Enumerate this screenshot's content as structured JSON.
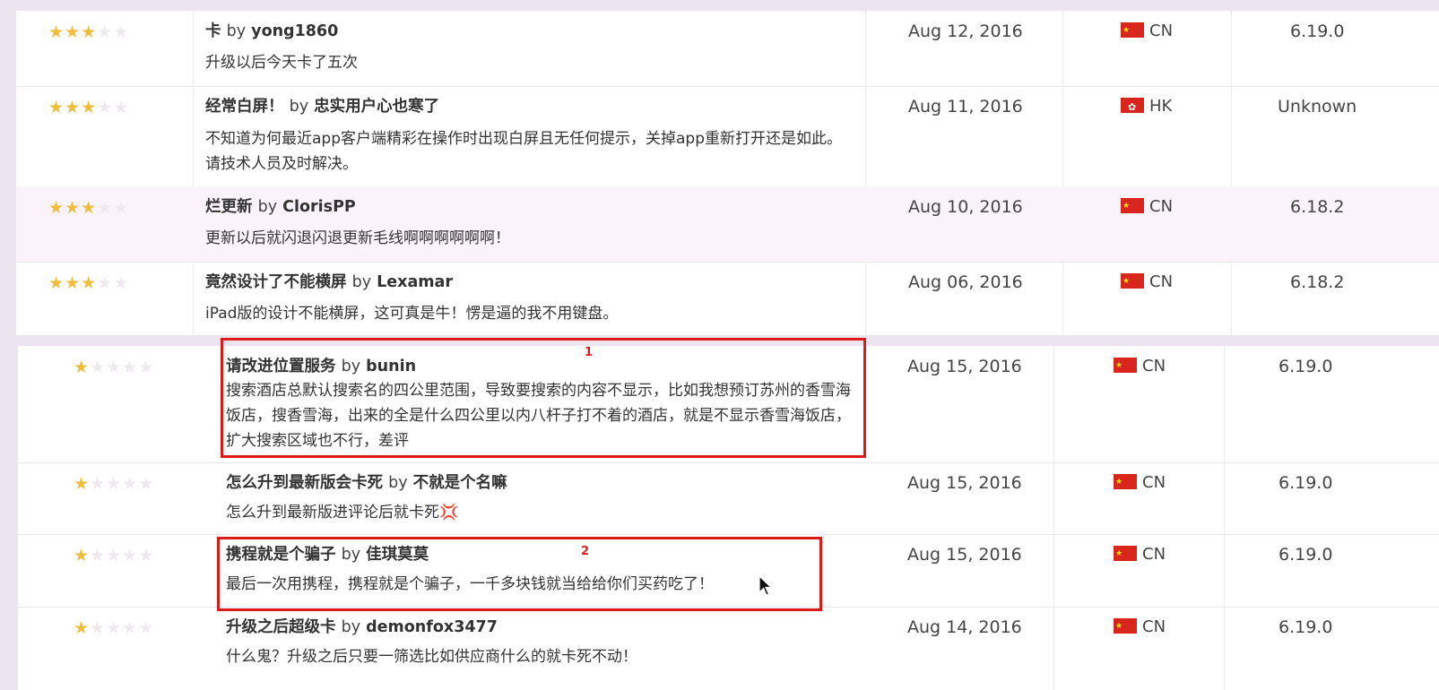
{
  "reviews_top": [
    {
      "stars": 3,
      "title": "卡",
      "by": "by",
      "author": "yong1860",
      "body": "升级以后今天卡了五次",
      "date": "Aug 12, 2016",
      "country": "CN",
      "flag": "cn-flag-icon",
      "version": "6.19.0"
    },
    {
      "stars": 3,
      "title": "经常白屏！",
      "by": "by",
      "author": "忠实用户心也寒了",
      "body": "不知道为何最近app客户端精彩在操作时出现白屏且无任何提示，关掉app重新打开还是如此。请技术人员及时解决。",
      "date": "Aug 11, 2016",
      "country": "HK",
      "flag": "hk-flag-icon",
      "version": "Unknown"
    },
    {
      "stars": 3,
      "title": "烂更新",
      "by": "by",
      "author": "ClorisPP",
      "body": "更新以后就闪退闪退更新毛线啊啊啊啊啊啊！",
      "date": "Aug 10, 2016",
      "country": "CN",
      "flag": "cn-flag-icon",
      "version": "6.18.2"
    },
    {
      "stars": 3,
      "title": "竟然设计了不能横屏",
      "by": "by",
      "author": "Lexamar",
      "body": "iPad版的设计不能横屏，这可真是牛！愣是逼的我不用键盘。",
      "date": "Aug 06, 2016",
      "country": "CN",
      "flag": "cn-flag-icon",
      "version": "6.18.2"
    }
  ],
  "reviews_bottom": [
    {
      "stars": 1,
      "title": "请改进位置服务",
      "by": "by",
      "author": "bunin",
      "body": "搜索酒店总默认搜索名的四公里范围，导致要搜索的内容不显示，比如我想预订苏州的香雪海饭店，搜香雪海，出来的全是什么四公里以内八杆子打不着的酒店，就是不显示香雪海饭店，扩大搜索区域也不行，差评",
      "date": "Aug 15, 2016",
      "country": "CN",
      "flag": "cn-flag-icon",
      "version": "6.19.0"
    },
    {
      "stars": 1,
      "title": "怎么升到最新版会卡死",
      "by": "by",
      "author": "不就是个名嘛",
      "body": "怎么升到最新版进评论后就卡死💢",
      "date": "Aug 15, 2016",
      "country": "CN",
      "flag": "cn-flag-icon",
      "version": "6.19.0"
    },
    {
      "stars": 1,
      "title": "携程就是个骗子",
      "by": "by",
      "author": "佳琪莫莫",
      "body": "最后一次用携程，携程就是个骗子，一千多块钱就当给给你们买药吃了！",
      "date": "Aug 15, 2016",
      "country": "CN",
      "flag": "cn-flag-icon",
      "version": "6.19.0"
    },
    {
      "stars": 1,
      "title": "升级之后超级卡",
      "by": "by",
      "author": "demonfox3477",
      "body": "什么鬼？升级之后只要一筛选比如供应商什么的就卡死不动！",
      "date": "Aug 14, 2016",
      "country": "CN",
      "flag": "cn-flag-icon",
      "version": "6.19.0"
    }
  ],
  "annotations": [
    {
      "label": "1"
    },
    {
      "label": "2"
    }
  ],
  "colors": {
    "star_on": "#efbd3a",
    "star_off": "#eee9ef",
    "annotation": "#dd1a1a",
    "highlight_row": "#fbf3fb"
  }
}
